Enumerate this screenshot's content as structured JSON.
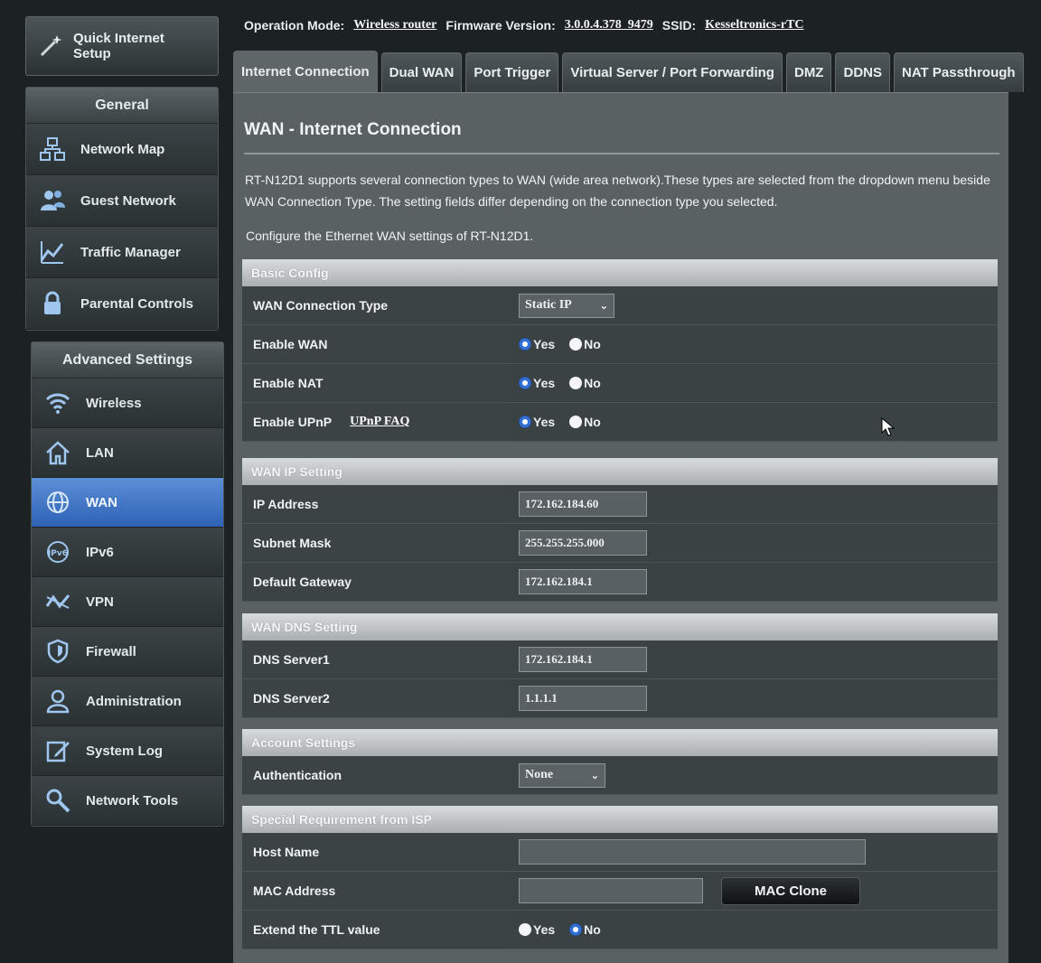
{
  "sidebar": {
    "qis_label": "Quick Internet Setup",
    "general": {
      "title": "General",
      "items": [
        {
          "label": "Network Map",
          "icon": "network-map-icon"
        },
        {
          "label": "Guest Network",
          "icon": "guest-network-icon"
        },
        {
          "label": "Traffic Manager",
          "icon": "traffic-manager-icon"
        },
        {
          "label": "Parental Controls",
          "icon": "lock-icon"
        }
      ]
    },
    "advanced": {
      "title": "Advanced Settings",
      "items": [
        {
          "label": "Wireless",
          "icon": "wifi-icon"
        },
        {
          "label": "LAN",
          "icon": "home-icon"
        },
        {
          "label": "WAN",
          "icon": "globe-icon",
          "active": true
        },
        {
          "label": "IPv6",
          "icon": "ipv6-icon"
        },
        {
          "label": "VPN",
          "icon": "vpn-icon"
        },
        {
          "label": "Firewall",
          "icon": "shield-icon"
        },
        {
          "label": "Administration",
          "icon": "user-icon"
        },
        {
          "label": "System Log",
          "icon": "edit-icon"
        },
        {
          "label": "Network Tools",
          "icon": "tools-icon"
        }
      ]
    }
  },
  "topbar": {
    "mode_label": "Operation Mode:",
    "mode_value": "Wireless router",
    "fw_label": "Firmware Version:",
    "fw_value": "3.0.0.4.378_9479",
    "ssid_label": "SSID:",
    "ssid_value": "Kesseltronics-rTC"
  },
  "tabs": [
    {
      "label": "Internet Connection",
      "active": true
    },
    {
      "label": "Dual WAN"
    },
    {
      "label": "Port Trigger"
    },
    {
      "label": "Virtual Server / Port Forwarding"
    },
    {
      "label": "DMZ"
    },
    {
      "label": "DDNS"
    },
    {
      "label": "NAT Passthrough"
    }
  ],
  "page": {
    "title": "WAN - Internet Connection",
    "description": "RT-N12D1 supports several connection types to WAN (wide area network).These types are selected from the dropdown menu beside WAN Connection Type. The setting fields differ depending on the connection type you selected.",
    "configure": "Configure the Ethernet WAN settings of RT-N12D1."
  },
  "basic": {
    "header": "Basic Config",
    "wan_type_label": "WAN Connection Type",
    "wan_type_value": "Static IP",
    "enable_wan_label": "Enable WAN",
    "enable_nat_label": "Enable NAT",
    "enable_upnp_label": "Enable UPnP",
    "upnp_faq": "UPnP FAQ",
    "yes": "Yes",
    "no": "No"
  },
  "wan_ip": {
    "header": "WAN IP Setting",
    "ip_label": "IP Address",
    "ip_value": "172.162.184.60",
    "mask_label": "Subnet Mask",
    "mask_value": "255.255.255.000",
    "gw_label": "Default Gateway",
    "gw_value": "172.162.184.1"
  },
  "dns": {
    "header": "WAN DNS Setting",
    "dns1_label": "DNS Server1",
    "dns1_value": "172.162.184.1",
    "dns2_label": "DNS Server2",
    "dns2_value": "1.1.1.1"
  },
  "account": {
    "header": "Account Settings",
    "auth_label": "Authentication",
    "auth_value": "None"
  },
  "isp": {
    "header": "Special Requirement from ISP",
    "host_label": "Host Name",
    "host_value": "",
    "mac_label": "MAC Address",
    "mac_value": "",
    "mac_clone": "MAC Clone",
    "ttl_label": "Extend the TTL value"
  },
  "colors": {
    "accent": "#2e62b6",
    "panel": "#5a6163",
    "section_header": "#c4c8c9"
  }
}
